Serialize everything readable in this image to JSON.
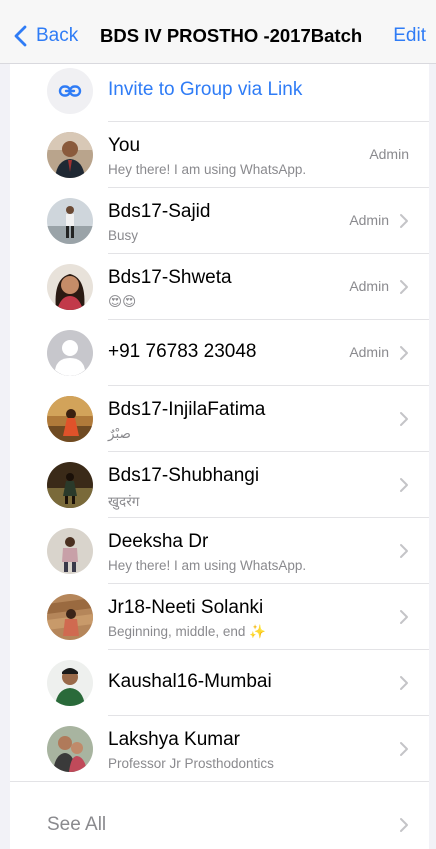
{
  "header": {
    "back_label": "Back",
    "title": "BDS IV PROSTHO -2017Batch",
    "edit_label": "Edit"
  },
  "invite": {
    "label": "Invite to Group via Link",
    "icon": "link-icon"
  },
  "participants": [
    {
      "name": "You",
      "status": "Hey there! I am using WhatsApp.",
      "role": "Admin",
      "chevron": false
    },
    {
      "name": "Bds17-Sajid",
      "status": "Busy",
      "role": "Admin",
      "chevron": true
    },
    {
      "name": "Bds17-Shweta",
      "status": "😍😍",
      "role": "Admin",
      "chevron": true
    },
    {
      "name": "+91 76783 23048",
      "status": "",
      "role": "Admin",
      "chevron": true
    },
    {
      "name": "Bds17-InjilaFatima",
      "status": "صبْرٌ",
      "role": "",
      "chevron": true
    },
    {
      "name": "Bds17-Shubhangi",
      "status": "खुदरंग",
      "role": "",
      "chevron": true
    },
    {
      "name": "Deeksha Dr",
      "status": "Hey there! I am using WhatsApp.",
      "role": "",
      "chevron": true
    },
    {
      "name": "Jr18-Neeti Solanki",
      "status": "Beginning, middle, end ✨",
      "role": "",
      "chevron": true
    },
    {
      "name": "Kaushal16-Mumbai",
      "status": "",
      "role": "",
      "chevron": true
    },
    {
      "name": "Lakshya Kumar",
      "status": "Professor Jr Prosthodontics",
      "role": "",
      "chevron": true
    }
  ],
  "see_all_label": "See All",
  "colors": {
    "accent": "#2f7cf6",
    "secondary_text": "#8a8a8e",
    "background": "#f2f2f7"
  }
}
